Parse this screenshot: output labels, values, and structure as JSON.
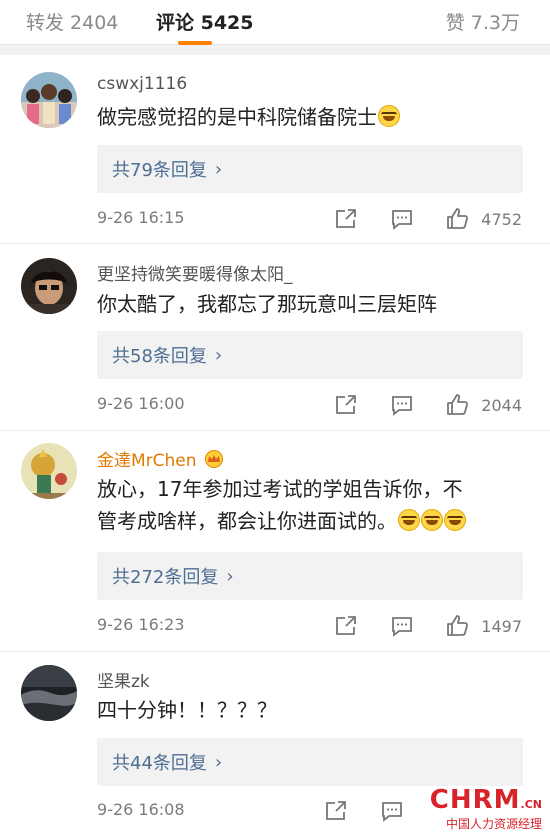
{
  "tabs": {
    "repost": "转发 2404",
    "comments": "评论 5425",
    "likes": "赞 7.3万"
  },
  "comments": [
    {
      "user": "cswxj1116",
      "text": "做完感觉招的是中科院储备院士",
      "replies": "共79条回复",
      "time": "9-26 16:15",
      "likes": "4752"
    },
    {
      "user": "更坚持微笑要暖得像太阳_",
      "text": "你太酷了，我都忘了那玩意叫三层矩阵",
      "replies": "共58条回复",
      "time": "9-26 16:00",
      "likes": "2044"
    },
    {
      "user": "金達MrChen",
      "text_line1": "放心，17年参加过考试的学姐告诉你，不",
      "text_line2": "管考成啥样，都会让你进面试的。",
      "replies": "共272条回复",
      "time": "9-26 16:23",
      "likes": "1497"
    },
    {
      "user": "坚果zk",
      "text": "四十分钟！！？？？",
      "replies": "共44条回复",
      "time": "9-26 16:08"
    }
  ],
  "watermark": {
    "brand": "CHRM",
    "suffix": ".CN",
    "tagline": "中国人力资源经理"
  },
  "colors": {
    "accent": "#ff8200",
    "link": "#4e6e93",
    "vip": "#e07a00",
    "watermark": "#d8232a"
  }
}
